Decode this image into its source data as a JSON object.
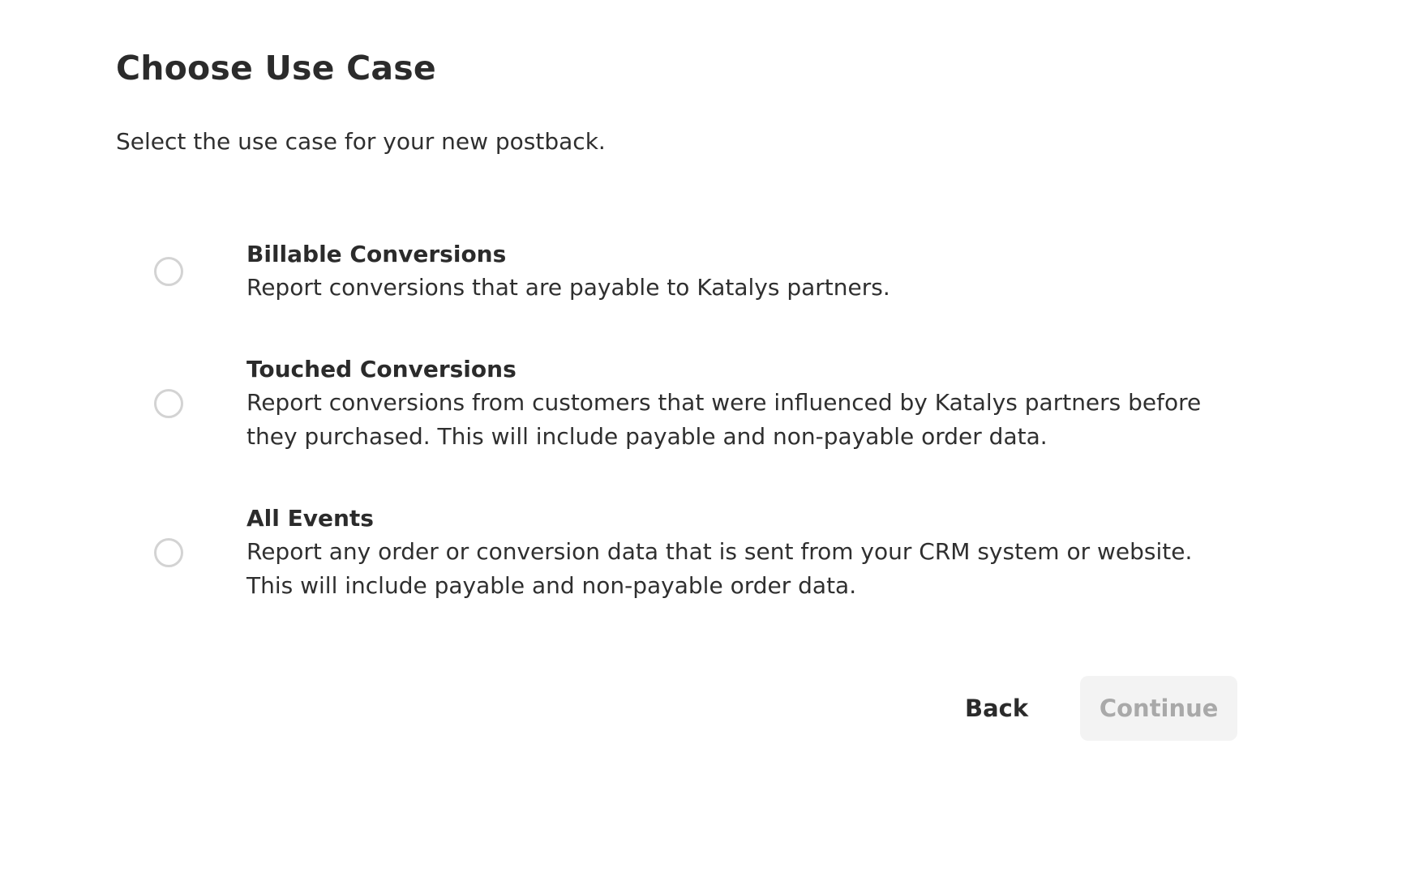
{
  "header": {
    "title": "Choose Use Case",
    "subtitle": "Select the use case for your new postback."
  },
  "options": [
    {
      "title": "Billable Conversions",
      "description": "Report conversions that are payable to Katalys partners.",
      "selected": false
    },
    {
      "title": "Touched Conversions",
      "description": "Report conversions from customers that were influenced by Katalys partners before they purchased. This will include payable and non-payable order data.",
      "selected": false
    },
    {
      "title": "All Events",
      "description": "Report any order or conversion data that is sent from your CRM system or website. This will include payable and non-payable order data.",
      "selected": false
    }
  ],
  "actions": {
    "back_label": "Back",
    "continue_label": "Continue",
    "continue_disabled": true
  },
  "colors": {
    "text": "#2b2b2b",
    "radio_border": "#d3d3d3",
    "disabled_bg": "#f3f3f3",
    "disabled_text": "#a9a9a9"
  }
}
